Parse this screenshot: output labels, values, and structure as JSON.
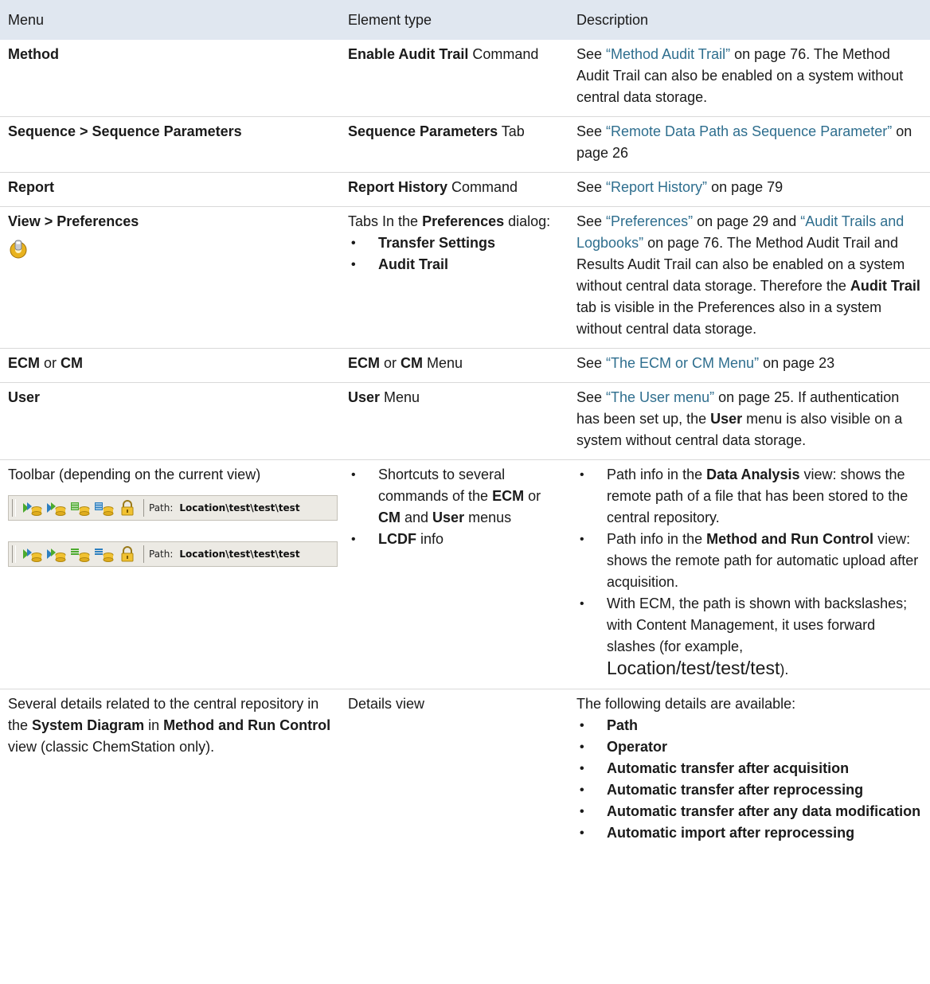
{
  "header": {
    "menu": "Menu",
    "element_type": "Element type",
    "description": "Description"
  },
  "rows": [
    {
      "menu": "Method",
      "type_bold": "Enable Audit Trail",
      "type_rest": " Command",
      "desc_pre": "See ",
      "desc_link": "“Method Audit Trail”",
      "desc_post": " on page 76. The Method Audit Trail can also be enabled on a system without central data storage."
    },
    {
      "menu": "Sequence > Sequence Parameters",
      "type_bold": "Sequence Parameters",
      "type_rest": " Tab",
      "desc_pre": "See ",
      "desc_link": "“Remote Data Path as Sequence Parameter”",
      "desc_post": " on page 26"
    },
    {
      "menu": "Report",
      "type_bold": "Report History",
      "type_rest": " Command",
      "desc_pre": "See ",
      "desc_link": "“Report History”",
      "desc_post": " on page 79"
    },
    {
      "menu": "View > Preferences",
      "icon": "preferences-icon",
      "type_pre": "Tabs In the ",
      "type_bold": "Preferences",
      "type_post": " dialog:",
      "type_bullets": [
        "Transfer Settings",
        "Audit Trail"
      ],
      "desc_pre": "See ",
      "desc_link1": "“Preferences”",
      "desc_mid1": " on page 29 and ",
      "desc_link2": "“Audit Trails and Logbooks”",
      "desc_mid2": " on page 76. The Method Audit Trail and Results Audit Trail can also be enabled on a system without central data storage. Therefore the ",
      "desc_bold": "Audit Trail",
      "desc_post": " tab is visible in the Preferences also in a system without central data storage."
    },
    {
      "menu_b1": "ECM",
      "menu_or": " or ",
      "menu_b2": "CM",
      "type_b1": "ECM",
      "type_or": " or ",
      "type_b2": "CM",
      "type_rest": " Menu",
      "desc_pre": "See ",
      "desc_link": "“The ECM or CM Menu”",
      "desc_post": " on page 23"
    },
    {
      "menu": "User",
      "type_bold": "User",
      "type_rest": " Menu",
      "desc_pre": "See ",
      "desc_link": "“The User menu”",
      "desc_mid": " on page 25. If authentication has been set up, the ",
      "desc_bold": "User",
      "desc_post": " menu is also visible on a system without central data storage."
    },
    {
      "menu": "Toolbar (depending on the current view)",
      "toolbar_path_label": "Path:",
      "toolbar_path_value": "Location\\test\\test\\test",
      "type_b1_pre": "Shortcuts to several commands of the ",
      "type_b1": "ECM",
      "type_b1_mid": " or ",
      "type_b2": "CM",
      "type_b2_mid": " and ",
      "type_b3": "User",
      "type_b3_post": " menus",
      "type_b4": "LCDF",
      "type_b4_post": " info",
      "d1_pre": "Path info in the ",
      "d1_bold": "Data Analysis",
      "d1_post": " view: shows the remote path of a file that has been stored to the central repository.",
      "d2_pre": "Path info in the ",
      "d2_bold": "Method and Run Control",
      "d2_post": " view: shows the remote path for automatic upload after acquisition.",
      "d3_pre": "With ECM, the path is shown with backslashes; with Content Management, it uses forward slashes (for example, ",
      "d3_big": "Location/test/test/test",
      "d3_post": ")."
    },
    {
      "m_pre": "Several details related to the central repository in the ",
      "m_b1": "System Diagram",
      "m_mid": " in ",
      "m_b2": "Method and Run Control",
      "m_post": " view (classic ChemStation only).",
      "type": "Details view",
      "desc_intro": "The following details are available:",
      "details": [
        "Path",
        "Operator",
        "Automatic transfer after acquisition",
        "Automatic transfer after reprocessing",
        "Automatic transfer after any data modification",
        "Automatic import after reprocessing"
      ]
    }
  ]
}
